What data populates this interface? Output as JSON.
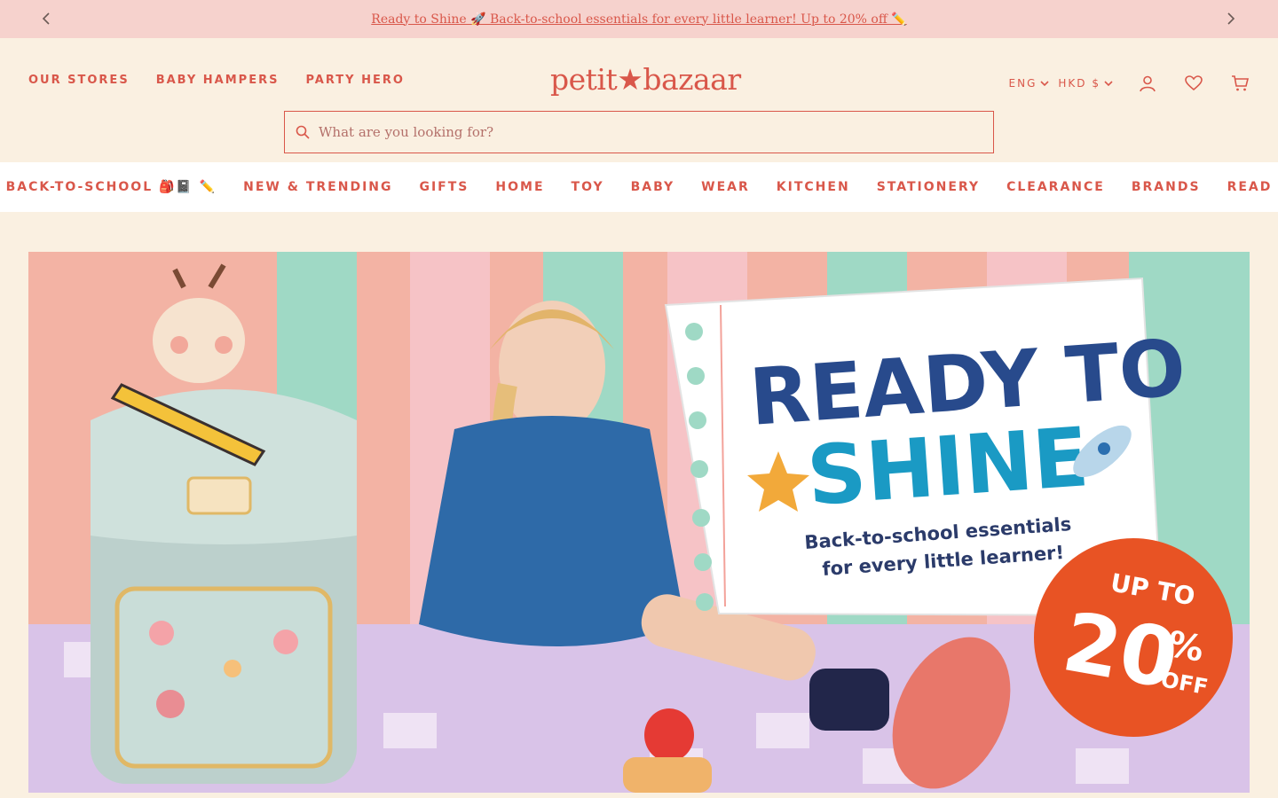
{
  "announcement": {
    "text": "Ready to Shine 🚀 Back-to-school essentials for every little learner! Up to 20% off ✏️"
  },
  "header": {
    "nav_left": [
      "OUR STORES",
      "BABY HAMPERS",
      "PARTY HERO"
    ],
    "logo": "petit★bazaar",
    "language": "ENG",
    "currency": "HKD $",
    "search_placeholder": "What are you looking for?"
  },
  "main_nav": [
    "BACK-TO-SCHOOL 🎒📓 ✏️",
    "NEW & TRENDING",
    "GIFTS",
    "HOME",
    "TOY",
    "BABY",
    "WEAR",
    "KITCHEN",
    "STATIONERY",
    "CLEARANCE",
    "BRANDS",
    "READ"
  ],
  "hero": {
    "line1": "READY TO",
    "line2": "SHINE",
    "sub1": "Back-to-school essentials",
    "sub2": "for every little learner!",
    "badge_top": "UP TO",
    "badge_value": "20",
    "badge_pct": "%",
    "badge_off": "OFF"
  },
  "colors": {
    "accent": "#d9574a",
    "background": "#faf0e1",
    "announce_bg": "#f6d2cd"
  },
  "icons": [
    "chevron-left-icon",
    "chevron-right-icon",
    "search-icon",
    "account-icon",
    "heart-icon",
    "cart-icon"
  ]
}
